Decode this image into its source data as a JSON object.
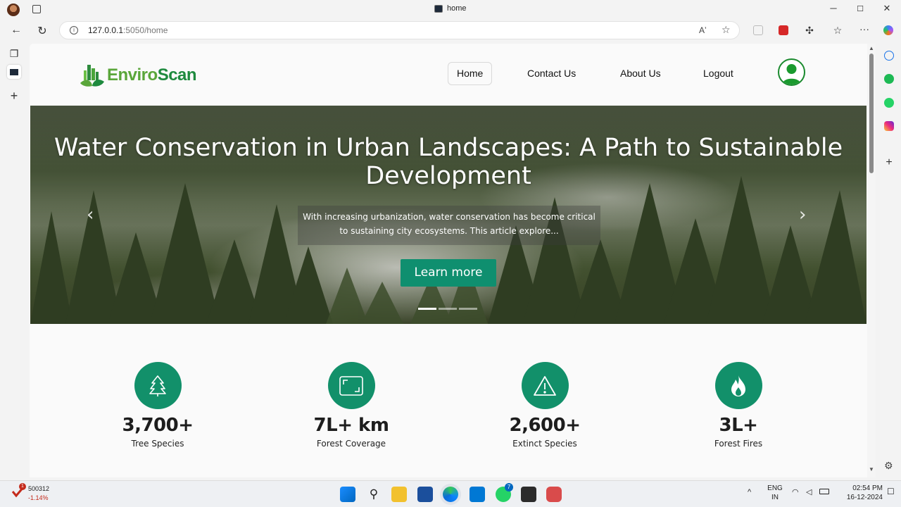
{
  "window": {
    "tab_title": "home",
    "minimize": "─",
    "maximize": "☐",
    "close": "✕"
  },
  "address_bar": {
    "url_host": "127.0.0.1",
    "url_rest": ":5050/home"
  },
  "site": {
    "logo_part1": "Enviro",
    "logo_part2": "Scan",
    "nav": [
      {
        "label": "Home",
        "active": true
      },
      {
        "label": "Contact Us",
        "active": false
      },
      {
        "label": "About Us",
        "active": false
      },
      {
        "label": "Logout",
        "active": false
      }
    ]
  },
  "hero": {
    "title": "Water Conservation in Urban Landscapes: A Path to Sustainable Development",
    "description": "With increasing urbanization, water conservation has become critical to sustaining city ecosystems. This article explore...",
    "button": "Learn more",
    "prev": "‹",
    "next": "›",
    "slides": 3,
    "active_slide": 1
  },
  "stats": [
    {
      "value": "3,700+",
      "label": "Tree Species",
      "icon": "tree-icon"
    },
    {
      "value": "7L+ km",
      "label": "Forest Coverage",
      "icon": "area-icon"
    },
    {
      "value": "2,600+",
      "label": "Extinct Species",
      "icon": "warning-icon"
    },
    {
      "value": "3L+",
      "label": "Forest Fires",
      "icon": "fire-icon"
    }
  ],
  "taskbar": {
    "stock_value": "500312",
    "stock_change": "-1.14%",
    "stock_badge": "1",
    "lang_line1": "ENG",
    "lang_line2": "IN",
    "time": "02:54 PM",
    "date": "16-12-2024",
    "whatsapp_badge": "7"
  },
  "colors": {
    "brand_green": "#12906a",
    "logo_light": "#5aa63a",
    "logo_dark": "#1e8a3e"
  }
}
